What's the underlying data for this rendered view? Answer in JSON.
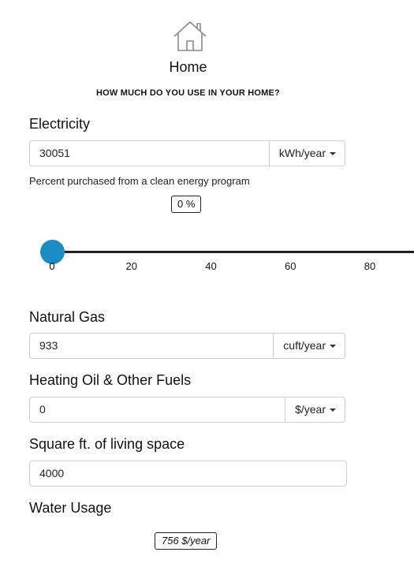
{
  "header": {
    "icon": "home-icon",
    "title": "Home",
    "question": "HOW MUCH DO YOU USE IN YOUR HOME?"
  },
  "electricity": {
    "label": "Electricity",
    "value": "30051",
    "unit": "kWh/year",
    "clean_label": "Percent purchased from a clean energy program",
    "clean_value_text": "0 %",
    "slider_value": 0,
    "slider_ticks": [
      "0",
      "20",
      "40",
      "60",
      "80"
    ]
  },
  "natural_gas": {
    "label": "Natural Gas",
    "value": "933",
    "unit": "cuft/year"
  },
  "heating_oil": {
    "label": "Heating Oil & Other Fuels",
    "value": "0",
    "unit": "$/year"
  },
  "square_feet": {
    "label": "Square ft. of living space",
    "value": "4000"
  },
  "water": {
    "label": "Water Usage",
    "value_text": "756 $/year"
  },
  "colors": {
    "slider_handle": "#1a8dc6",
    "slider_track": "#222222",
    "input_border": "#cfcfcf"
  }
}
